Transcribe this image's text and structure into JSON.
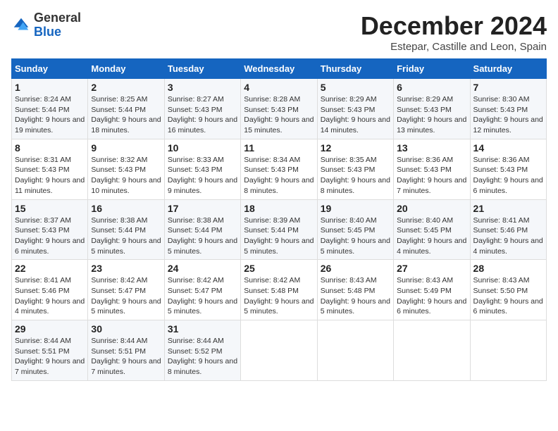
{
  "logo": {
    "general": "General",
    "blue": "Blue"
  },
  "header": {
    "month": "December 2024",
    "location": "Estepar, Castille and Leon, Spain"
  },
  "weekdays": [
    "Sunday",
    "Monday",
    "Tuesday",
    "Wednesday",
    "Thursday",
    "Friday",
    "Saturday"
  ],
  "weeks": [
    [
      {
        "day": "1",
        "sunrise": "8:24 AM",
        "sunset": "5:44 PM",
        "daylight": "9 hours and 19 minutes."
      },
      {
        "day": "2",
        "sunrise": "8:25 AM",
        "sunset": "5:44 PM",
        "daylight": "9 hours and 18 minutes."
      },
      {
        "day": "3",
        "sunrise": "8:27 AM",
        "sunset": "5:43 PM",
        "daylight": "9 hours and 16 minutes."
      },
      {
        "day": "4",
        "sunrise": "8:28 AM",
        "sunset": "5:43 PM",
        "daylight": "9 hours and 15 minutes."
      },
      {
        "day": "5",
        "sunrise": "8:29 AM",
        "sunset": "5:43 PM",
        "daylight": "9 hours and 14 minutes."
      },
      {
        "day": "6",
        "sunrise": "8:29 AM",
        "sunset": "5:43 PM",
        "daylight": "9 hours and 13 minutes."
      },
      {
        "day": "7",
        "sunrise": "8:30 AM",
        "sunset": "5:43 PM",
        "daylight": "9 hours and 12 minutes."
      }
    ],
    [
      {
        "day": "8",
        "sunrise": "8:31 AM",
        "sunset": "5:43 PM",
        "daylight": "9 hours and 11 minutes."
      },
      {
        "day": "9",
        "sunrise": "8:32 AM",
        "sunset": "5:43 PM",
        "daylight": "9 hours and 10 minutes."
      },
      {
        "day": "10",
        "sunrise": "8:33 AM",
        "sunset": "5:43 PM",
        "daylight": "9 hours and 9 minutes."
      },
      {
        "day": "11",
        "sunrise": "8:34 AM",
        "sunset": "5:43 PM",
        "daylight": "9 hours and 8 minutes."
      },
      {
        "day": "12",
        "sunrise": "8:35 AM",
        "sunset": "5:43 PM",
        "daylight": "9 hours and 8 minutes."
      },
      {
        "day": "13",
        "sunrise": "8:36 AM",
        "sunset": "5:43 PM",
        "daylight": "9 hours and 7 minutes."
      },
      {
        "day": "14",
        "sunrise": "8:36 AM",
        "sunset": "5:43 PM",
        "daylight": "9 hours and 6 minutes."
      }
    ],
    [
      {
        "day": "15",
        "sunrise": "8:37 AM",
        "sunset": "5:43 PM",
        "daylight": "9 hours and 6 minutes."
      },
      {
        "day": "16",
        "sunrise": "8:38 AM",
        "sunset": "5:44 PM",
        "daylight": "9 hours and 5 minutes."
      },
      {
        "day": "17",
        "sunrise": "8:38 AM",
        "sunset": "5:44 PM",
        "daylight": "9 hours and 5 minutes."
      },
      {
        "day": "18",
        "sunrise": "8:39 AM",
        "sunset": "5:44 PM",
        "daylight": "9 hours and 5 minutes."
      },
      {
        "day": "19",
        "sunrise": "8:40 AM",
        "sunset": "5:45 PM",
        "daylight": "9 hours and 5 minutes."
      },
      {
        "day": "20",
        "sunrise": "8:40 AM",
        "sunset": "5:45 PM",
        "daylight": "9 hours and 4 minutes."
      },
      {
        "day": "21",
        "sunrise": "8:41 AM",
        "sunset": "5:46 PM",
        "daylight": "9 hours and 4 minutes."
      }
    ],
    [
      {
        "day": "22",
        "sunrise": "8:41 AM",
        "sunset": "5:46 PM",
        "daylight": "9 hours and 4 minutes."
      },
      {
        "day": "23",
        "sunrise": "8:42 AM",
        "sunset": "5:47 PM",
        "daylight": "9 hours and 5 minutes."
      },
      {
        "day": "24",
        "sunrise": "8:42 AM",
        "sunset": "5:47 PM",
        "daylight": "9 hours and 5 minutes."
      },
      {
        "day": "25",
        "sunrise": "8:42 AM",
        "sunset": "5:48 PM",
        "daylight": "9 hours and 5 minutes."
      },
      {
        "day": "26",
        "sunrise": "8:43 AM",
        "sunset": "5:48 PM",
        "daylight": "9 hours and 5 minutes."
      },
      {
        "day": "27",
        "sunrise": "8:43 AM",
        "sunset": "5:49 PM",
        "daylight": "9 hours and 6 minutes."
      },
      {
        "day": "28",
        "sunrise": "8:43 AM",
        "sunset": "5:50 PM",
        "daylight": "9 hours and 6 minutes."
      }
    ],
    [
      {
        "day": "29",
        "sunrise": "8:44 AM",
        "sunset": "5:51 PM",
        "daylight": "9 hours and 7 minutes."
      },
      {
        "day": "30",
        "sunrise": "8:44 AM",
        "sunset": "5:51 PM",
        "daylight": "9 hours and 7 minutes."
      },
      {
        "day": "31",
        "sunrise": "8:44 AM",
        "sunset": "5:52 PM",
        "daylight": "9 hours and 8 minutes."
      },
      null,
      null,
      null,
      null
    ]
  ]
}
